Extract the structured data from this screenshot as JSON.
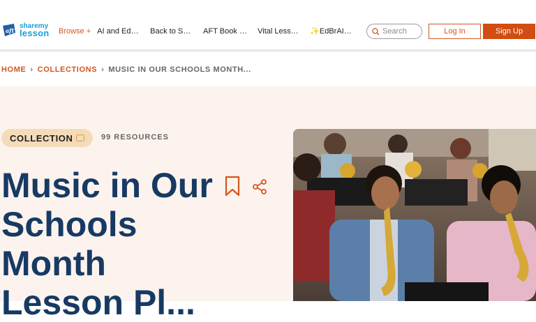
{
  "header": {
    "logo": {
      "line1": "sharemy",
      "line2": "lesson",
      "mark": "aft"
    },
    "nav": {
      "browse": "Browse +",
      "items": [
        "AI and Educ...",
        "Back to Sch...",
        "AFT Book Cl...",
        "Vital Lesso...",
        "✨EdBrAIn I..."
      ]
    },
    "search_placeholder": "Search",
    "login_label": "Log In",
    "signup_label": "Sign Up"
  },
  "breadcrumb": {
    "home": "HOME",
    "sep": "›",
    "collections": "COLLECTIONS",
    "current": "MUSIC IN OUR SCHOOLS MONTH..."
  },
  "hero": {
    "badge": "COLLECTION",
    "resources": "99 RESOURCES",
    "title": "Music in Our Schools Month Lesson Pl..."
  },
  "colors": {
    "accent": "#d4561e",
    "title": "#173a63",
    "hero_bg": "#fdf3ee",
    "badge_bg": "#f5dcb8"
  },
  "icons": [
    "search-icon",
    "bookmark-icon",
    "share-icon",
    "collection-icon"
  ]
}
